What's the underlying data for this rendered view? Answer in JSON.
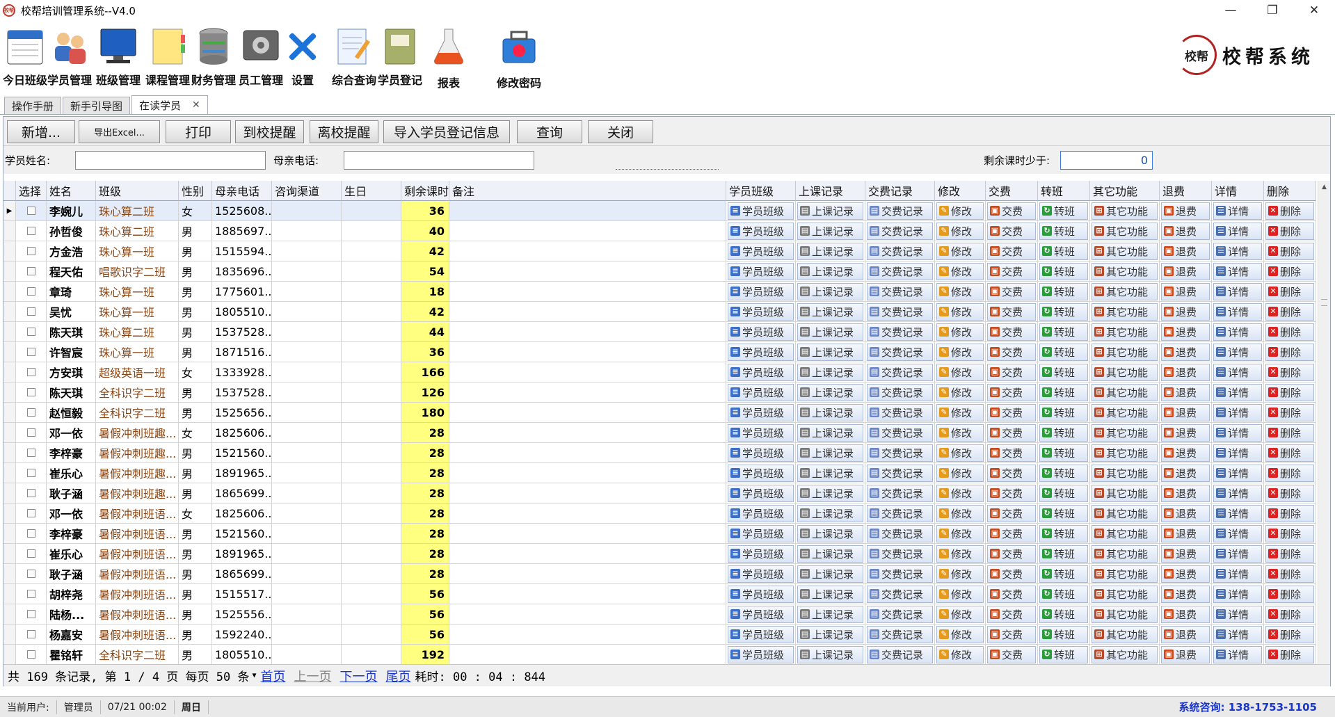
{
  "window": {
    "title": "校帮培训管理系统--V4.0",
    "app_icon_text": "校帮",
    "min": "—",
    "max": "❐",
    "close": "✕"
  },
  "toolbar": [
    {
      "label": "今日班级",
      "icon": "calendar-icon"
    },
    {
      "label": "学员管理",
      "icon": "users-icon"
    },
    {
      "label": "班级管理",
      "icon": "monitor-icon"
    },
    {
      "label": "课程管理",
      "icon": "notes-icon"
    },
    {
      "label": "财务管理",
      "icon": "database-icon"
    },
    {
      "label": "员工管理",
      "icon": "settings-box-icon"
    },
    {
      "label": "设置",
      "icon": "tools-icon"
    },
    {
      "label": "综合查询",
      "icon": "document-edit-icon"
    },
    {
      "label": "学员登记",
      "icon": "register-book-icon"
    },
    {
      "label": "报表",
      "icon": "flask-icon"
    },
    {
      "label": "修改密码",
      "icon": "toolbox-icon"
    }
  ],
  "brand": {
    "seal": "校帮",
    "text": "校帮系统"
  },
  "tabs": [
    {
      "label": "操作手册"
    },
    {
      "label": "新手引导图"
    },
    {
      "label": "在读学员",
      "active": true,
      "close": "✕"
    }
  ],
  "actions": [
    "新增...",
    "导出Excel...",
    "打印",
    "到校提醒",
    "离校提醒",
    "导入学员登记信息",
    "查询",
    "关闭"
  ],
  "search": {
    "name_label": "学员姓名:",
    "name_value": "",
    "phone_label": "母亲电话:",
    "phone_value": "",
    "remain_label": "剩余课时少于:",
    "remain_value": "0"
  },
  "columns": [
    "选择",
    "姓名",
    "班级",
    "性别",
    "母亲电话",
    "咨询渠道",
    "生日",
    "剩余课时",
    "备注",
    "学员班级",
    "上课记录",
    "交费记录",
    "修改",
    "交费",
    "转班",
    "其它功能",
    "退费",
    "详情",
    "删除"
  ],
  "op_buttons": [
    "学员班级",
    "上课记录",
    "交费记录",
    "修改",
    "交费",
    "转班",
    "其它功能",
    "退费",
    "详情",
    "删除"
  ],
  "rows": [
    {
      "name": "李婉儿",
      "class": "珠心算二班",
      "gender": "女",
      "phone": "1525608...",
      "remaining": "36"
    },
    {
      "name": "孙哲俊",
      "class": "珠心算二班",
      "gender": "男",
      "phone": "1885697...",
      "remaining": "40"
    },
    {
      "name": "方金浩",
      "class": "珠心算一班",
      "gender": "男",
      "phone": "1515594...",
      "remaining": "42"
    },
    {
      "name": "程天佑",
      "class": "唱歌识字二班",
      "gender": "男",
      "phone": "1835696...",
      "remaining": "54"
    },
    {
      "name": "章琦",
      "class": "珠心算一班",
      "gender": "男",
      "phone": "1775601...",
      "remaining": "18"
    },
    {
      "name": "吴忧",
      "class": "珠心算一班",
      "gender": "男",
      "phone": "1805510...",
      "remaining": "42"
    },
    {
      "name": "陈天琪",
      "class": "珠心算二班",
      "gender": "男",
      "phone": "1537528...",
      "remaining": "44"
    },
    {
      "name": "许智宸",
      "class": "珠心算一班",
      "gender": "男",
      "phone": "1871516...",
      "remaining": "36"
    },
    {
      "name": "方安琪",
      "class": "超级英语一班",
      "gender": "女",
      "phone": "1333928...",
      "remaining": "166"
    },
    {
      "name": "陈天琪",
      "class": "全科识字二班",
      "gender": "男",
      "phone": "1537528...",
      "remaining": "126"
    },
    {
      "name": "赵恒毅",
      "class": "全科识字二班",
      "gender": "男",
      "phone": "1525656...",
      "remaining": "180"
    },
    {
      "name": "邓一依",
      "class": "暑假冲刺班趣...",
      "gender": "女",
      "phone": "1825606...",
      "remaining": "28"
    },
    {
      "name": "李梓豪",
      "class": "暑假冲刺班趣...",
      "gender": "男",
      "phone": "1521560...",
      "remaining": "28"
    },
    {
      "name": "崔乐心",
      "class": "暑假冲刺班趣...",
      "gender": "男",
      "phone": "1891965...",
      "remaining": "28"
    },
    {
      "name": "耿子涵",
      "class": "暑假冲刺班趣...",
      "gender": "男",
      "phone": "1865699...",
      "remaining": "28"
    },
    {
      "name": "邓一依",
      "class": "暑假冲刺班语...",
      "gender": "女",
      "phone": "1825606...",
      "remaining": "28"
    },
    {
      "name": "李梓豪",
      "class": "暑假冲刺班语...",
      "gender": "男",
      "phone": "1521560...",
      "remaining": "28"
    },
    {
      "name": "崔乐心",
      "class": "暑假冲刺班语...",
      "gender": "男",
      "phone": "1891965...",
      "remaining": "28"
    },
    {
      "name": "耿子涵",
      "class": "暑假冲刺班语...",
      "gender": "男",
      "phone": "1865699...",
      "remaining": "28"
    },
    {
      "name": "胡梓尧",
      "class": "暑假冲刺班语...",
      "gender": "男",
      "phone": "1515517...",
      "remaining": "56"
    },
    {
      "name": "陆杨...",
      "class": "暑假冲刺班语...",
      "gender": "男",
      "phone": "1525556...",
      "remaining": "56"
    },
    {
      "name": "杨嘉安",
      "class": "暑假冲刺班语...",
      "gender": "男",
      "phone": "1592240...",
      "remaining": "56"
    },
    {
      "name": "瞿铭轩",
      "class": "全科识字二班",
      "gender": "男",
      "phone": "1805510...",
      "remaining": "192"
    }
  ],
  "pager": {
    "summary": "共 169 条记录, 第 1 / 4 页 每页 50 条",
    "first": "首页",
    "prev": "上一页",
    "next": "下一页",
    "last": "尾页",
    "elapsed": "耗时: 00 : 04 : 844"
  },
  "status": {
    "user_label": "当前用户:",
    "user": "管理员",
    "datetime": "07/21 00:02",
    "weekday": "周日",
    "hotline": "系统咨询: 138-1753-1105"
  },
  "colors": {
    "remaining_bg": "#ffff80",
    "class_text": "#8b4513",
    "link": "#1a35c9",
    "op_button": "#d9e4f5"
  }
}
